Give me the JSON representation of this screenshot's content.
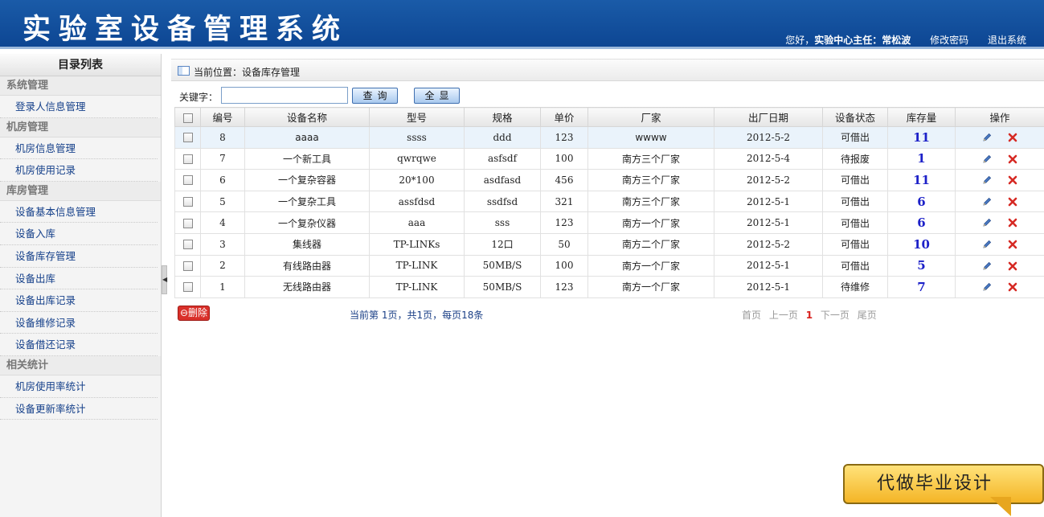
{
  "header": {
    "title": "实验室设备管理系统",
    "greeting": "您好，",
    "user": "实验中心主任：常松波",
    "change_password": "修改密码",
    "logout": "退出系统"
  },
  "sidebar": {
    "title": "目录列表",
    "groups": [
      {
        "label": "系统管理",
        "items": [
          "登录人信息管理"
        ]
      },
      {
        "label": "机房管理",
        "items": [
          "机房信息管理",
          "机房使用记录"
        ]
      },
      {
        "label": "库房管理",
        "items": [
          "设备基本信息管理",
          "设备入库",
          "设备库存管理",
          "设备出库",
          "设备出库记录",
          "设备维修记录",
          "设备借还记录"
        ]
      },
      {
        "label": "相关统计",
        "items": [
          "机房使用率统计",
          "设备更新率统计"
        ]
      }
    ]
  },
  "breadcrumb": "当前位置：设备库存管理",
  "search": {
    "label": "关键字：",
    "value": "",
    "query_button": "查询",
    "showall_button": "全显"
  },
  "table": {
    "columns": [
      "编号",
      "设备名称",
      "型号",
      "规格",
      "单价",
      "厂家",
      "出厂日期",
      "设备状态",
      "库存量",
      "操作"
    ],
    "rows": [
      [
        "8",
        "aaaa",
        "ssss",
        "ddd",
        "123",
        "wwww",
        "2012-5-2",
        "可借出",
        "11"
      ],
      [
        "7",
        "一个新工具",
        "qwrqwe",
        "asfsdf",
        "100",
        "南方三个厂家",
        "2012-5-4",
        "待报废",
        "1"
      ],
      [
        "6",
        "一个复杂容器",
        "20*100",
        "asdfasd",
        "456",
        "南方三个厂家",
        "2012-5-2",
        "可借出",
        "11"
      ],
      [
        "5",
        "一个复杂工具",
        "assfdsd",
        "ssdfsd",
        "321",
        "南方三个厂家",
        "2012-5-1",
        "可借出",
        "6"
      ],
      [
        "4",
        "一个复杂仪器",
        "aaa",
        "sss",
        "123",
        "南方一个厂家",
        "2012-5-1",
        "可借出",
        "6"
      ],
      [
        "3",
        "集线器",
        "TP-LINKs",
        "12口",
        "50",
        "南方二个厂家",
        "2012-5-2",
        "可借出",
        "10"
      ],
      [
        "2",
        "有线路由器",
        "TP-LINK",
        "50MB/S",
        "100",
        "南方一个厂家",
        "2012-5-1",
        "可借出",
        "5"
      ],
      [
        "1",
        "无线路由器",
        "TP-LINK",
        "50MB/S",
        "123",
        "南方一个厂家",
        "2012-5-1",
        "待维修",
        "7"
      ]
    ],
    "highlight_row": 0
  },
  "footer": {
    "delete_button": "⊖删除",
    "page_info": "当前第 1页，共1页，每页18条",
    "pager": {
      "first": "首页",
      "prev": "上一页",
      "current": "1",
      "next": "下一页",
      "last": "尾页"
    }
  },
  "promo": "代做毕业设计",
  "colors": {
    "header": "#0d4693",
    "link": "#15408a",
    "stock": "#1c20c8",
    "danger": "#d9302a"
  },
  "icons": {
    "breadcrumb": "panel-icon",
    "edit": "pencil-icon",
    "delete": "x-icon",
    "collapse": "triangle-left-icon"
  }
}
